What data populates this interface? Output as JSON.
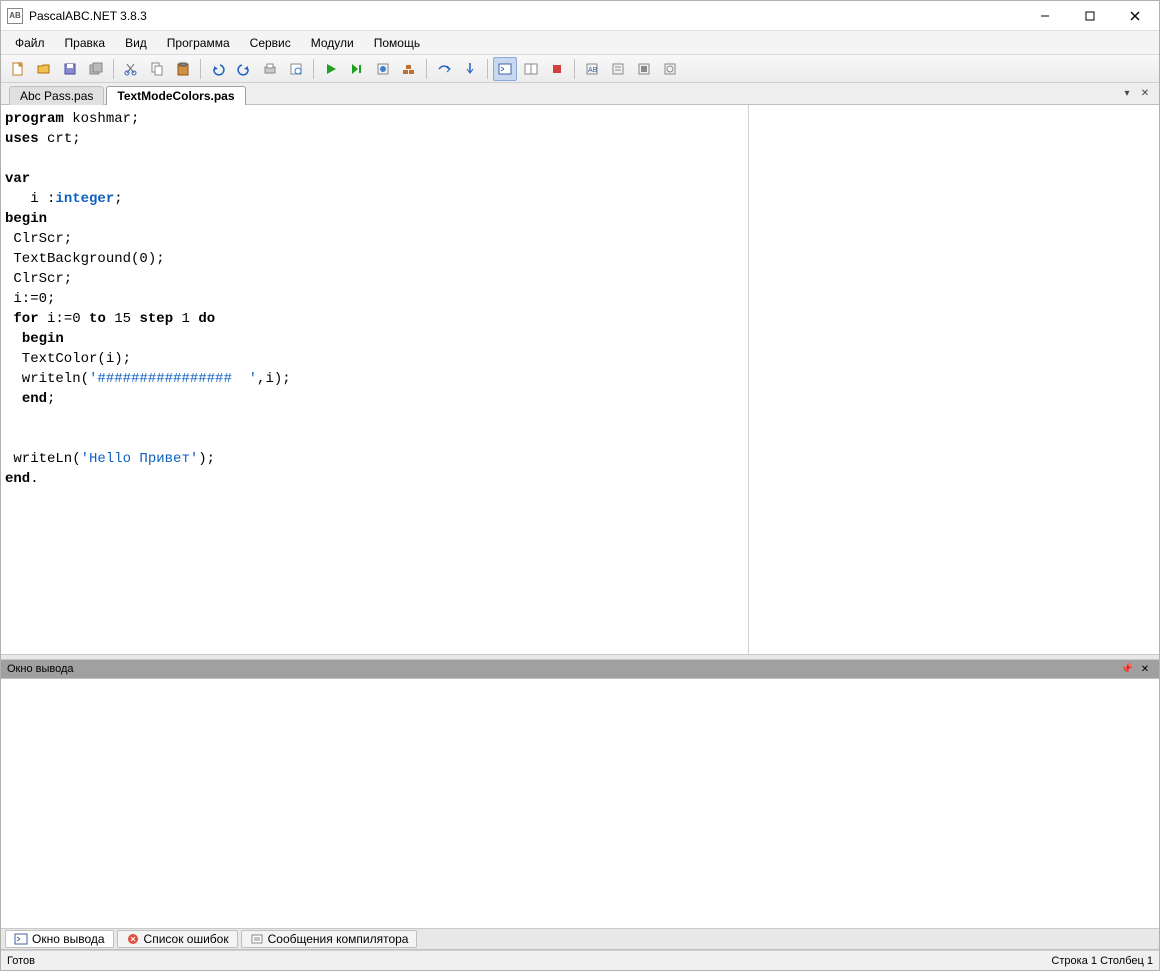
{
  "window": {
    "title": "PascalABC.NET 3.8.3"
  },
  "menus": [
    "Файл",
    "Правка",
    "Вид",
    "Программа",
    "Сервис",
    "Модули",
    "Помощь"
  ],
  "tabs": [
    {
      "label": "Abc Pass.pas",
      "active": false
    },
    {
      "label": "TextModeColors.pas",
      "active": true
    }
  ],
  "code": {
    "l1_kw": "program",
    "l1_rest": " koshmar;",
    "l2_kw": "uses",
    "l2_rest": " crt;",
    "l3_blank": "",
    "l4_kw": "var",
    "l5_pre": "   i :",
    "l5_type": "integer",
    "l5_post": ";",
    "l6_kw": "begin",
    "l7": " ClrScr;",
    "l8_pre": " TextBackground(",
    "l8_num": "0",
    "l8_post": ");",
    "l9": " ClrScr;",
    "l10_pre": " i:=",
    "l10_num": "0",
    "l10_post": ";",
    "l11_sp": " ",
    "l11_for": "for",
    "l11_a": " i:=",
    "l11_n0": "0",
    "l11_sp2": " ",
    "l11_to": "to",
    "l11_sp3": " ",
    "l11_n15": "15",
    "l11_sp4": " ",
    "l11_step": "step",
    "l11_sp5": " ",
    "l11_n1": "1",
    "l11_sp6": " ",
    "l11_do": "do",
    "l12_sp": "  ",
    "l12_kw": "begin",
    "l13": "  TextColor(i);",
    "l14_pre": "  writeln(",
    "l14_str": "'################  '",
    "l14_post": ",i);",
    "l15_sp": "  ",
    "l15_kw": "end",
    "l15_post": ";",
    "l16_blank": "",
    "l17_blank": "",
    "l18_pre": " writeLn(",
    "l18_str": "'Hello Привет'",
    "l18_post": ");",
    "l19_kw": "end",
    "l19_post": "."
  },
  "output_panel": {
    "title": "Окно вывода"
  },
  "bottom_tabs": [
    "Окно вывода",
    "Список ошибок",
    "Сообщения компилятора"
  ],
  "status": {
    "left": "Готов",
    "line_label": "Строка",
    "line_value": "1",
    "col_label": "Столбец",
    "col_value": "1"
  },
  "toolbar_icons": [
    "new-file",
    "open-file",
    "save-file",
    "save-all",
    "|",
    "cut",
    "copy",
    "paste",
    "|",
    "undo",
    "redo",
    "print",
    "print-preview",
    "|",
    "run",
    "run-no-debug",
    "compile",
    "build",
    "|",
    "step-over",
    "step-into",
    "|",
    "terminal-toggle-a",
    "terminal-toggle-b",
    "stop",
    "|",
    "tool-a",
    "tool-b",
    "tool-c",
    "tool-d"
  ],
  "toolbar_toggled": [
    "terminal-toggle-a"
  ]
}
